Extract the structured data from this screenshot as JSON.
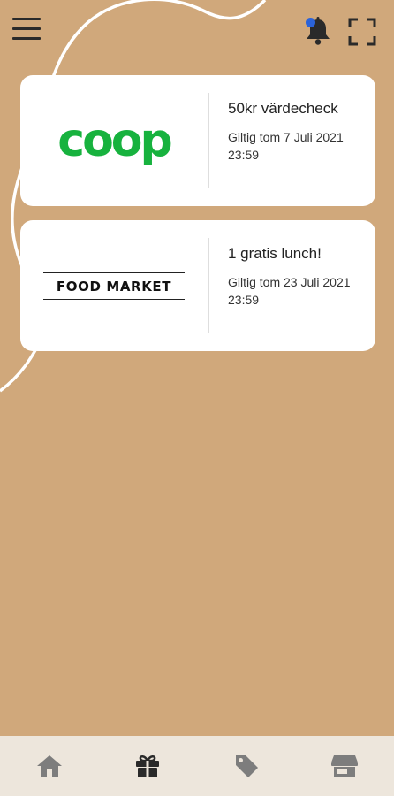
{
  "header": {
    "menu_icon": "hamburger-menu-icon",
    "notification_icon": "bell-icon",
    "notification_dot_color": "#2b63d9",
    "fullscreen_icon": "expand-icon"
  },
  "offers": [
    {
      "brand": "coop",
      "brand_color": "#17b23e",
      "title": "50kr värdecheck",
      "validity": "Giltig tom 7 Juli 2021 23:59"
    },
    {
      "brand": "FOOD MARKET",
      "title": "1 gratis lunch!",
      "validity": "Giltig tom 23 Juli 2021 23:59"
    }
  ],
  "bottom_nav": {
    "items": [
      {
        "icon": "home-icon",
        "active": false
      },
      {
        "icon": "gift-icon",
        "active": true
      },
      {
        "icon": "tag-icon",
        "active": false
      },
      {
        "icon": "store-icon",
        "active": false
      }
    ]
  },
  "colors": {
    "background": "#d0a87b",
    "card": "#ffffff",
    "nav_background": "#ede6dc",
    "nav_icon": "#7d7d7d",
    "nav_icon_active": "#2a2a2a"
  }
}
